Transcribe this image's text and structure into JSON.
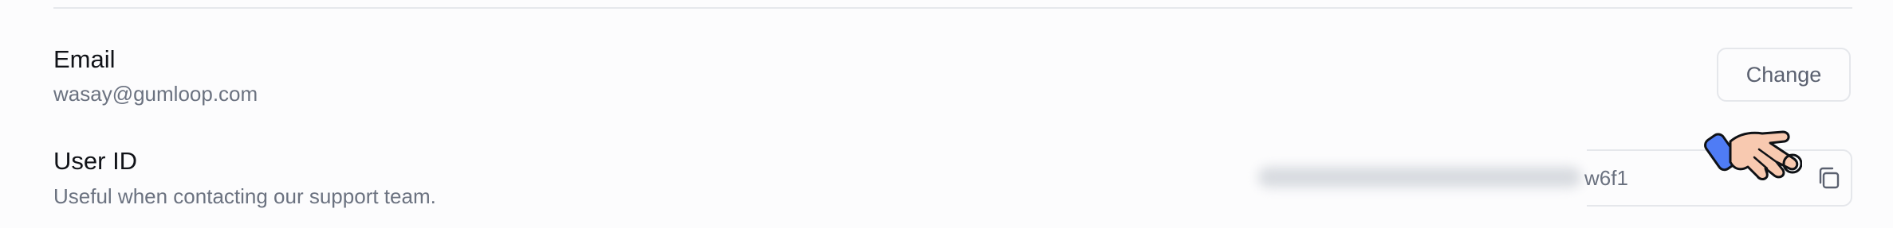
{
  "email": {
    "label": "Email",
    "value": "wasay@gumloop.com",
    "change_label": "Change"
  },
  "user_id": {
    "label": "User ID",
    "description": "Useful when contacting our support team.",
    "value_visible_tail": "w6f1"
  },
  "icons": {
    "copy": "copy-icon",
    "cursor": "hand-pointer-icon"
  },
  "colors": {
    "cursor_cuff": "#4f7cf5"
  }
}
